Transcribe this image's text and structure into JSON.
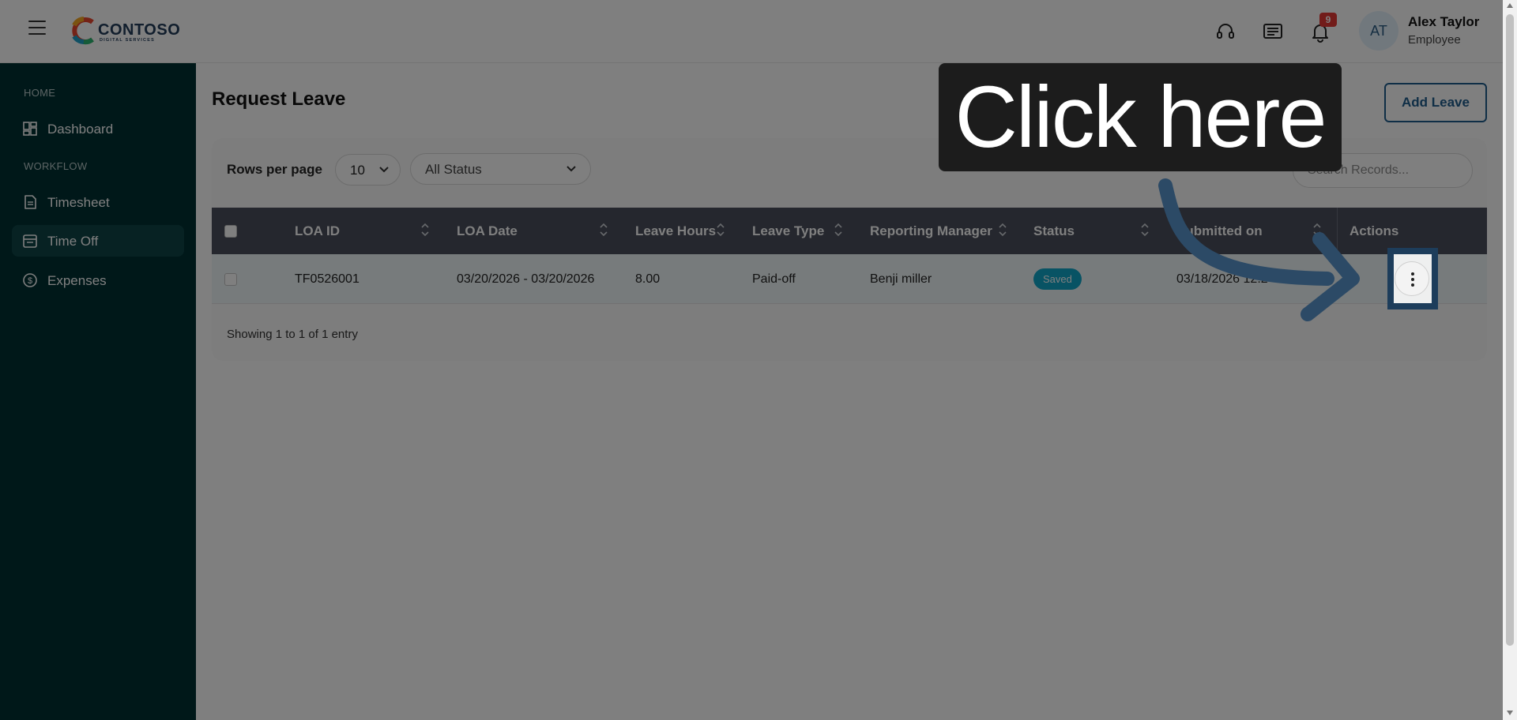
{
  "header": {
    "logo_name": "CONTOSO",
    "logo_sub": "DIGITAL SERVICES",
    "notification_count": "9",
    "avatar_initials": "AT",
    "user_name": "Alex Taylor",
    "user_role": "Employee"
  },
  "sidebar": {
    "sections": [
      "HOME",
      "WORKFLOW"
    ],
    "items": [
      {
        "label": "Dashboard",
        "icon": "dashboard-icon"
      },
      {
        "label": "Timesheet",
        "icon": "timesheet-icon"
      },
      {
        "label": "Time Off",
        "icon": "calendar-icon",
        "active": true
      },
      {
        "label": "Expenses",
        "icon": "dollar-icon"
      }
    ]
  },
  "main": {
    "title": "Request Leave",
    "add_button": "Add Leave",
    "rows_per_page_label": "Rows per page",
    "rows_per_page_value": "10",
    "status_filter_value": "All Status",
    "search_placeholder": "Search Records...",
    "columns": [
      "LOA ID",
      "LOA Date",
      "Leave Hours",
      "Leave Type",
      "Reporting Manager",
      "Status",
      "Submitted on",
      "Actions"
    ],
    "rows": [
      {
        "loa_id": "TF0526001",
        "loa_date": "03/20/2026 - 03/20/2026",
        "leave_hours": "8.00",
        "leave_type": "Paid-off",
        "reporting_manager": "Benji miller",
        "status": "Saved",
        "submitted_on": "03/18/2026 12:2"
      }
    ],
    "footer": "Showing 1 to 1 of 1 entry"
  },
  "overlay": {
    "callout_text": "Click here"
  },
  "colors": {
    "sidebar_bg": "#003033",
    "accent": "#1f5d8c",
    "status_badge": "#11a7c9",
    "table_header": "#4a4f5c",
    "notification_badge": "#e53935"
  }
}
